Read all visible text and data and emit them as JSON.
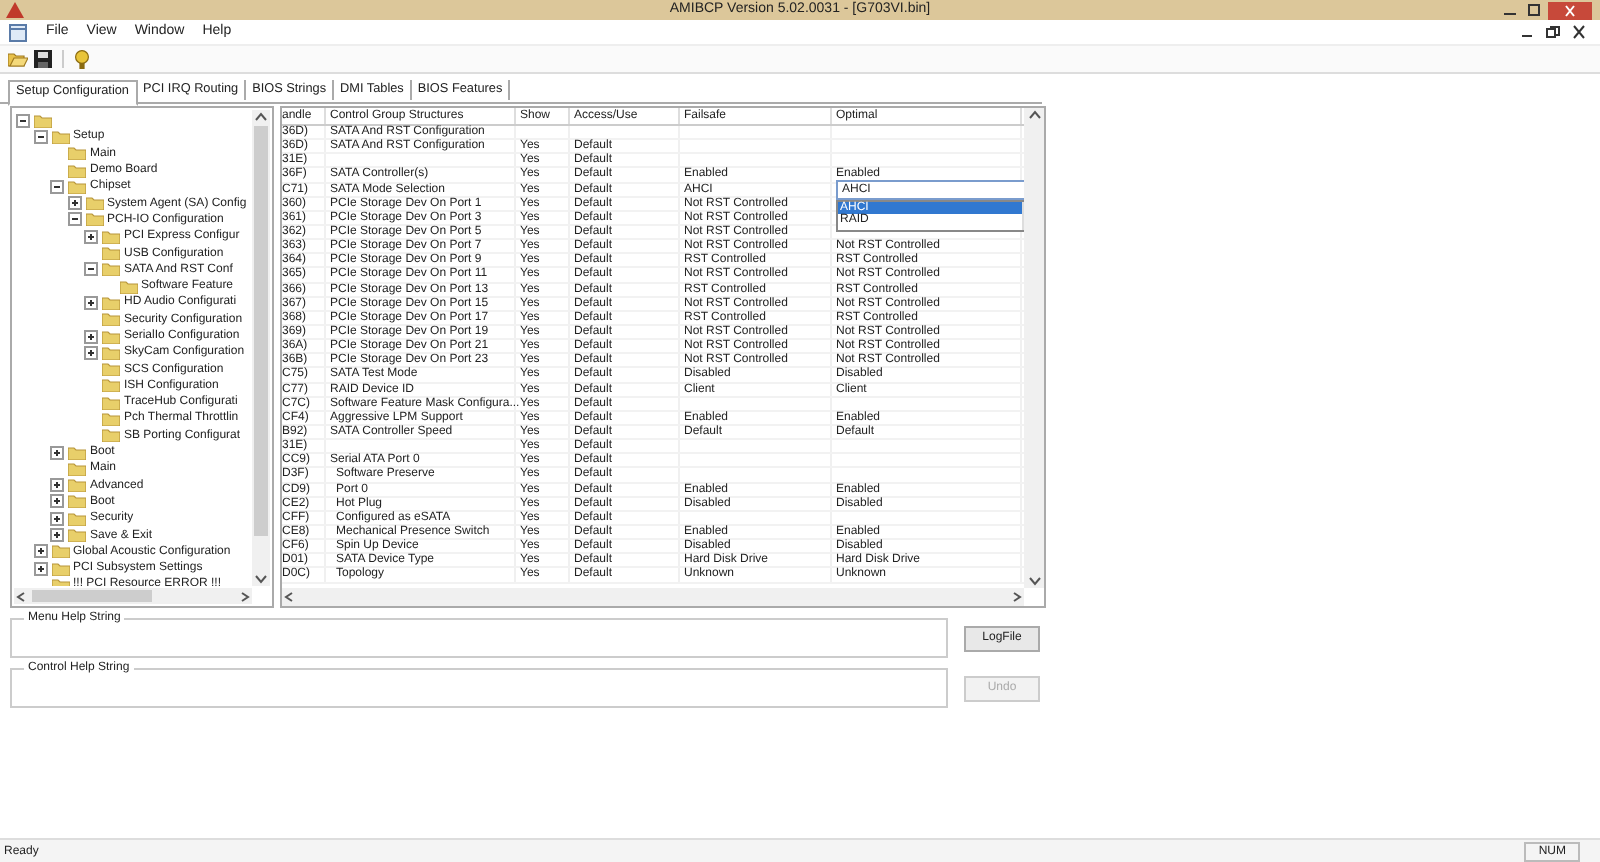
{
  "window": {
    "title": "AMIBCP Version 5.02.0031 - [G703VI.bin]"
  },
  "menu": [
    "File",
    "View",
    "Window",
    "Help"
  ],
  "tabs": [
    {
      "label": "Setup Configuration",
      "selected": true
    },
    {
      "label": "PCI IRQ Routing",
      "selected": false
    },
    {
      "label": "BIOS Strings",
      "selected": false
    },
    {
      "label": "DMI Tables",
      "selected": false
    },
    {
      "label": "BIOS Features",
      "selected": false
    }
  ],
  "tree": [
    {
      "expanded": true,
      "children": [
        {
          "label": "Setup",
          "expanded": true,
          "children": [
            {
              "label": "Main"
            },
            {
              "label": "Demo Board"
            },
            {
              "label": "Chipset",
              "expanded": true,
              "children": [
                {
                  "label": "System Agent (SA) Config",
                  "expanded": false
                },
                {
                  "label": "PCH-IO Configuration",
                  "expanded": true,
                  "children": [
                    {
                      "label": "PCI Express Configur",
                      "expanded": false
                    },
                    {
                      "label": "USB Configuration"
                    },
                    {
                      "label": "SATA And RST Conf",
                      "expanded": true,
                      "children": [
                        {
                          "label": "Software Feature"
                        }
                      ]
                    },
                    {
                      "label": "HD Audio Configurati",
                      "expanded": false
                    },
                    {
                      "label": "Security Configuration"
                    },
                    {
                      "label": "SerialIo Configuration",
                      "expanded": false
                    },
                    {
                      "label": "SkyCam Configuration",
                      "expanded": false
                    },
                    {
                      "label": "SCS Configuration"
                    },
                    {
                      "label": "ISH Configuration"
                    },
                    {
                      "label": "TraceHub Configurati"
                    },
                    {
                      "label": "Pch Thermal Throttlin"
                    },
                    {
                      "label": "SB Porting Configurat"
                    }
                  ]
                }
              ]
            },
            {
              "label": "Boot",
              "expanded": false
            },
            {
              "label": "Main"
            },
            {
              "label": "Advanced",
              "expanded": false
            },
            {
              "label": "Boot",
              "expanded": false
            },
            {
              "label": "Security",
              "expanded": false
            },
            {
              "label": "Save & Exit",
              "expanded": false
            }
          ]
        },
        {
          "label": "Global Acoustic Configuration",
          "expanded": false
        },
        {
          "label": "PCI Subsystem Settings",
          "expanded": false
        },
        {
          "label": "!!! PCI Resource ERROR !!!"
        }
      ]
    }
  ],
  "table": {
    "columns": [
      "andle",
      "Control Group Structures",
      "Show",
      "Access/Use",
      "Failsafe",
      "Optimal"
    ],
    "rows": [
      {
        "kind": "item",
        "cells": [
          "36D)",
          "SATA And RST Configuration",
          "",
          "",
          "",
          ""
        ]
      },
      {
        "kind": "item",
        "cells": [
          "36D)",
          "SATA And RST Configuration",
          "Yes",
          "Default",
          "",
          ""
        ]
      },
      {
        "kind": "item",
        "cells": [
          "31E)",
          "",
          "Yes",
          "Default",
          "",
          ""
        ]
      },
      {
        "kind": "item",
        "cells": [
          "36F)",
          "SATA Controller(s)",
          "Yes",
          "Default",
          "Enabled",
          "Enabled"
        ]
      },
      {
        "kind": "item",
        "cells": [
          "C71)",
          "SATA Mode Selection",
          "Yes",
          "Default",
          "AHCI",
          ""
        ]
      },
      {
        "kind": "item",
        "cells": [
          "360)",
          "PCIe Storage Dev On Port 1",
          "Yes",
          "Default",
          "Not RST Controlled",
          ""
        ]
      },
      {
        "kind": "item",
        "cells": [
          "361)",
          "PCIe Storage Dev On Port 3",
          "Yes",
          "Default",
          "Not RST Controlled",
          ""
        ]
      },
      {
        "kind": "item",
        "cells": [
          "362)",
          "PCIe Storage Dev On Port 5",
          "Yes",
          "Default",
          "Not RST Controlled",
          ""
        ]
      },
      {
        "kind": "item",
        "cells": [
          "363)",
          "PCIe Storage Dev On Port 7",
          "Yes",
          "Default",
          "Not RST Controlled",
          "Not RST Controlled"
        ]
      },
      {
        "kind": "item",
        "cells": [
          "364)",
          "PCIe Storage Dev On Port 9",
          "Yes",
          "Default",
          "RST Controlled",
          "RST Controlled"
        ]
      },
      {
        "kind": "item",
        "cells": [
          "365)",
          "PCIe Storage Dev On Port 11",
          "Yes",
          "Default",
          "Not RST Controlled",
          "Not RST Controlled"
        ]
      },
      {
        "kind": "item",
        "cells": [
          "366)",
          "PCIe Storage Dev On Port 13",
          "Yes",
          "Default",
          "RST Controlled",
          "RST Controlled"
        ]
      },
      {
        "kind": "item",
        "cells": [
          "367)",
          "PCIe Storage Dev On Port 15",
          "Yes",
          "Default",
          "Not RST Controlled",
          "Not RST Controlled"
        ]
      },
      {
        "kind": "item",
        "cells": [
          "368)",
          "PCIe Storage Dev On Port 17",
          "Yes",
          "Default",
          "RST Controlled",
          "RST Controlled"
        ]
      },
      {
        "kind": "item",
        "cells": [
          "369)",
          "PCIe Storage Dev On Port 19",
          "Yes",
          "Default",
          "Not RST Controlled",
          "Not RST Controlled"
        ]
      },
      {
        "kind": "item",
        "cells": [
          "36A)",
          "PCIe Storage Dev On Port 21",
          "Yes",
          "Default",
          "Not RST Controlled",
          "Not RST Controlled"
        ]
      },
      {
        "kind": "item",
        "cells": [
          "36B)",
          "PCIe Storage Dev On Port 23",
          "Yes",
          "Default",
          "Not RST Controlled",
          "Not RST Controlled"
        ]
      },
      {
        "kind": "item",
        "cells": [
          "C75)",
          "SATA Test Mode",
          "Yes",
          "Default",
          "Disabled",
          "Disabled"
        ]
      },
      {
        "kind": "item",
        "cells": [
          "C77)",
          "RAID Device ID",
          "Yes",
          "Default",
          "Client",
          "Client"
        ]
      },
      {
        "kind": "item",
        "cells": [
          "C7C)",
          "Software Feature Mask Configura...",
          "Yes",
          "Default",
          "",
          ""
        ]
      },
      {
        "kind": "item",
        "cells": [
          "CF4)",
          "Aggressive LPM Support",
          "Yes",
          "Default",
          "Enabled",
          "Enabled"
        ]
      },
      {
        "kind": "item",
        "cells": [
          "B92)",
          "SATA Controller Speed",
          "Yes",
          "Default",
          "Default",
          "Default"
        ]
      },
      {
        "kind": "item",
        "cells": [
          "31E)",
          "",
          "Yes",
          "Default",
          "",
          ""
        ]
      },
      {
        "kind": "item",
        "cells": [
          "CC9)",
          "Serial ATA Port 0",
          "Yes",
          "Default",
          "",
          ""
        ]
      },
      {
        "kind": "sub",
        "cells": [
          "D3F)",
          "Software Preserve",
          "Yes",
          "Default",
          "",
          ""
        ]
      },
      {
        "kind": "sub",
        "cells": [
          "CD9)",
          "Port 0",
          "Yes",
          "Default",
          "Enabled",
          "Enabled"
        ]
      },
      {
        "kind": "sub",
        "cells": [
          "CE2)",
          "Hot Plug",
          "Yes",
          "Default",
          "Disabled",
          "Disabled"
        ]
      },
      {
        "kind": "sub",
        "cells": [
          "CFF)",
          "Configured as eSATA",
          "Yes",
          "Default",
          "",
          ""
        ]
      },
      {
        "kind": "sub",
        "cells": [
          "CE8)",
          "Mechanical Presence Switch",
          "Yes",
          "Default",
          "Enabled",
          "Enabled"
        ]
      },
      {
        "kind": "sub",
        "cells": [
          "CF6)",
          "Spin Up Device",
          "Yes",
          "Default",
          "Disabled",
          "Disabled"
        ]
      },
      {
        "kind": "sub",
        "cells": [
          "D01)",
          "SATA Device Type",
          "Yes",
          "Default",
          "Hard Disk Drive",
          "Hard Disk Drive"
        ]
      },
      {
        "kind": "sub",
        "cells": [
          "D0C)",
          "Topology",
          "Yes",
          "Default",
          "Unknown",
          "Unknown"
        ]
      }
    ]
  },
  "mode_dropdown": {
    "value": "AHCI",
    "options": [
      {
        "label": "AHCI",
        "selected": true
      },
      {
        "label": "RAID",
        "selected": false
      }
    ]
  },
  "menu_help": {
    "title": "Menu Help String",
    "button": "LogFile"
  },
  "control_help": {
    "title": "Control Help String",
    "button": "Undo",
    "button_disabled": true
  },
  "status_bar": {
    "text": "Ready",
    "indicator": "NUM"
  }
}
